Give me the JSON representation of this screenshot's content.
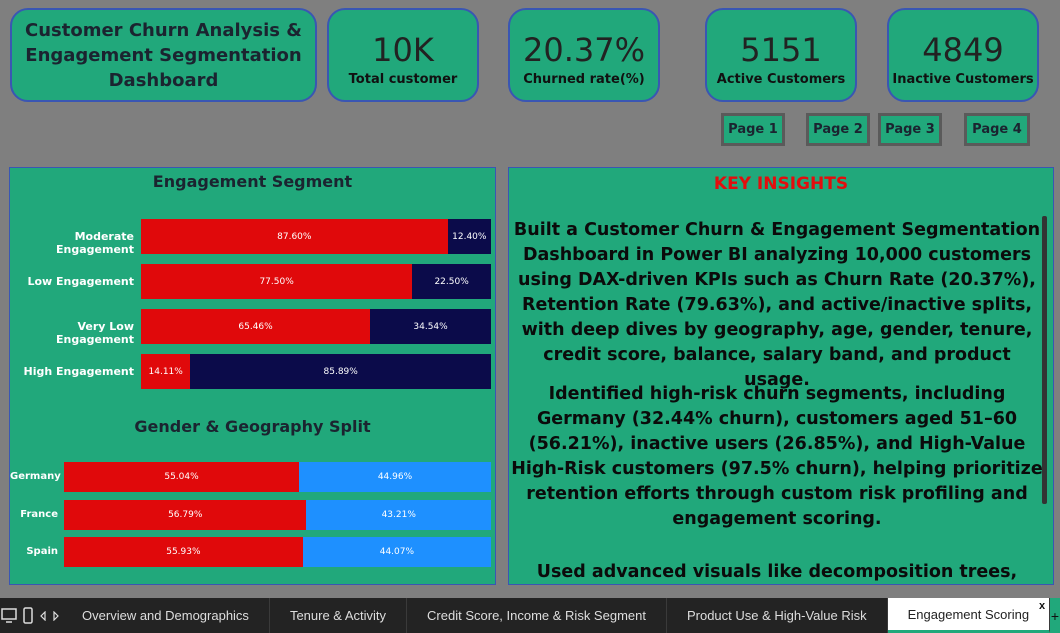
{
  "header": {
    "title": "Customer Churn Analysis & Engagement Segmentation Dashboard",
    "kpis": [
      {
        "value": "10K",
        "label": "Total customer"
      },
      {
        "value": "20.37%",
        "label": "Churned rate(%)"
      },
      {
        "value": "5151",
        "label": "Active Customers"
      },
      {
        "value": "4849",
        "label": "Inactive Customers"
      }
    ]
  },
  "pages": [
    "Page 1",
    "Page 2",
    "Page 3",
    "Page 4"
  ],
  "engagement_panel": {
    "title": "Engagement Segment",
    "rows": [
      {
        "label": "Moderate Engagement",
        "churned": 87.6,
        "churned_label": "87.60%",
        "retained_label": "12.40%"
      },
      {
        "label": "Low Engagement",
        "churned": 77.5,
        "churned_label": "77.50%",
        "retained_label": "22.50%"
      },
      {
        "label": "Very Low Engagement",
        "churned": 65.46,
        "churned_label": "65.46%",
        "retained_label": "34.54%"
      },
      {
        "label": "High Engagement",
        "churned": 14.11,
        "churned_label": "14.11%",
        "retained_label": "85.89%"
      }
    ],
    "geo_title": "Gender & Geography Split",
    "geo_rows": [
      {
        "label": "Germany",
        "first": 55.04,
        "first_label": "55.04%",
        "second_label": "44.96%"
      },
      {
        "label": "France",
        "first": 56.79,
        "first_label": "56.79%",
        "second_label": "43.21%"
      },
      {
        "label": "Spain",
        "first": 55.93,
        "first_label": "55.93%",
        "second_label": "44.07%"
      }
    ],
    "colors": {
      "churned": "#e0090b",
      "retained": "#0b0b4a",
      "second": "#1e90ff"
    }
  },
  "insights": {
    "title": "KEY INSIGHTS",
    "p1": "Built a Customer Churn & Engagement Segmentation Dashboard in Power BI analyzing 10,000 customers using DAX-driven KPIs such as Churn Rate (20.37%), Retention Rate (79.63%), and active/inactive splits, with deep dives by geography, age, gender, tenure, credit score, balance, salary band, and product usage.",
    "p2": "Identified high-risk churn segments, including Germany (32.44% churn), customers aged 51–60 (56.21%), inactive users (26.85%), and High-Value High-Risk customers (97.5% churn), helping prioritize retention efforts through custom risk profiling and engagement scoring.",
    "p3": "Used advanced visuals like decomposition trees,"
  },
  "tabbar": {
    "tabs": [
      "Overview and Demographics",
      "Tenure & Activity",
      "Credit Score, Income & Risk Segment",
      "Product Use & High-Value Risk",
      "Engagement Scoring"
    ],
    "active_index": 4,
    "close_glyph": "x"
  },
  "accent": "#21a87b"
}
